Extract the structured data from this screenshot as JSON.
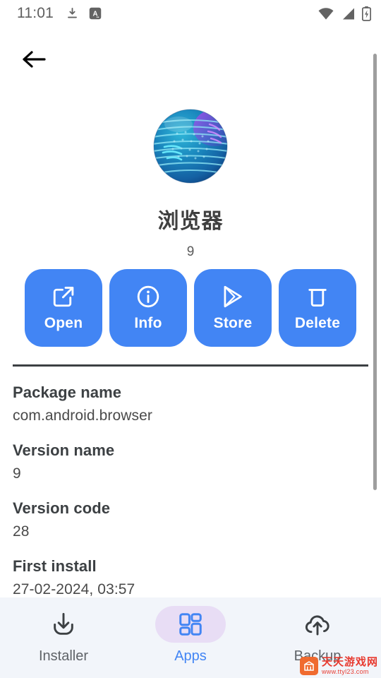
{
  "status_bar": {
    "clock": "11:01",
    "left_icons": [
      "download-icon",
      "translate-badge-icon"
    ],
    "badge_letter": "A",
    "right_icons": [
      "wifi-icon",
      "cellular-signal-icon",
      "battery-charging-icon"
    ]
  },
  "navigation": {
    "back_icon": "back-arrow-icon"
  },
  "app": {
    "icon": "globe-browser-icon",
    "name": "浏览器",
    "version": "9"
  },
  "actions": [
    {
      "label": "Open",
      "icon": "external-link-icon"
    },
    {
      "label": "Info",
      "icon": "info-circle-icon"
    },
    {
      "label": "Store",
      "icon": "play-store-icon"
    },
    {
      "label": "Delete",
      "icon": "trash-icon"
    }
  ],
  "details": [
    {
      "label": "Package name",
      "value": "com.android.browser"
    },
    {
      "label": "Version name",
      "value": "9"
    },
    {
      "label": "Version code",
      "value": "28"
    },
    {
      "label": "First install",
      "value": "27-02-2024, 03:57"
    }
  ],
  "bottom_nav": {
    "items": [
      {
        "label": "Installer",
        "icon": "download-tray-icon",
        "active": false
      },
      {
        "label": "Apps",
        "icon": "grid-apps-icon",
        "active": true
      },
      {
        "label": "Backup",
        "icon": "cloud-upload-icon",
        "active": false
      }
    ]
  },
  "watermark": {
    "title": "天天游戏网",
    "url": "www.ttyl23.com"
  },
  "colors": {
    "accent_blue": "#4285f4",
    "nav_bg": "#f2f5fa",
    "active_pill": "#e8ddf5",
    "text_dark": "#3c4043",
    "divider": "#3c4043"
  }
}
